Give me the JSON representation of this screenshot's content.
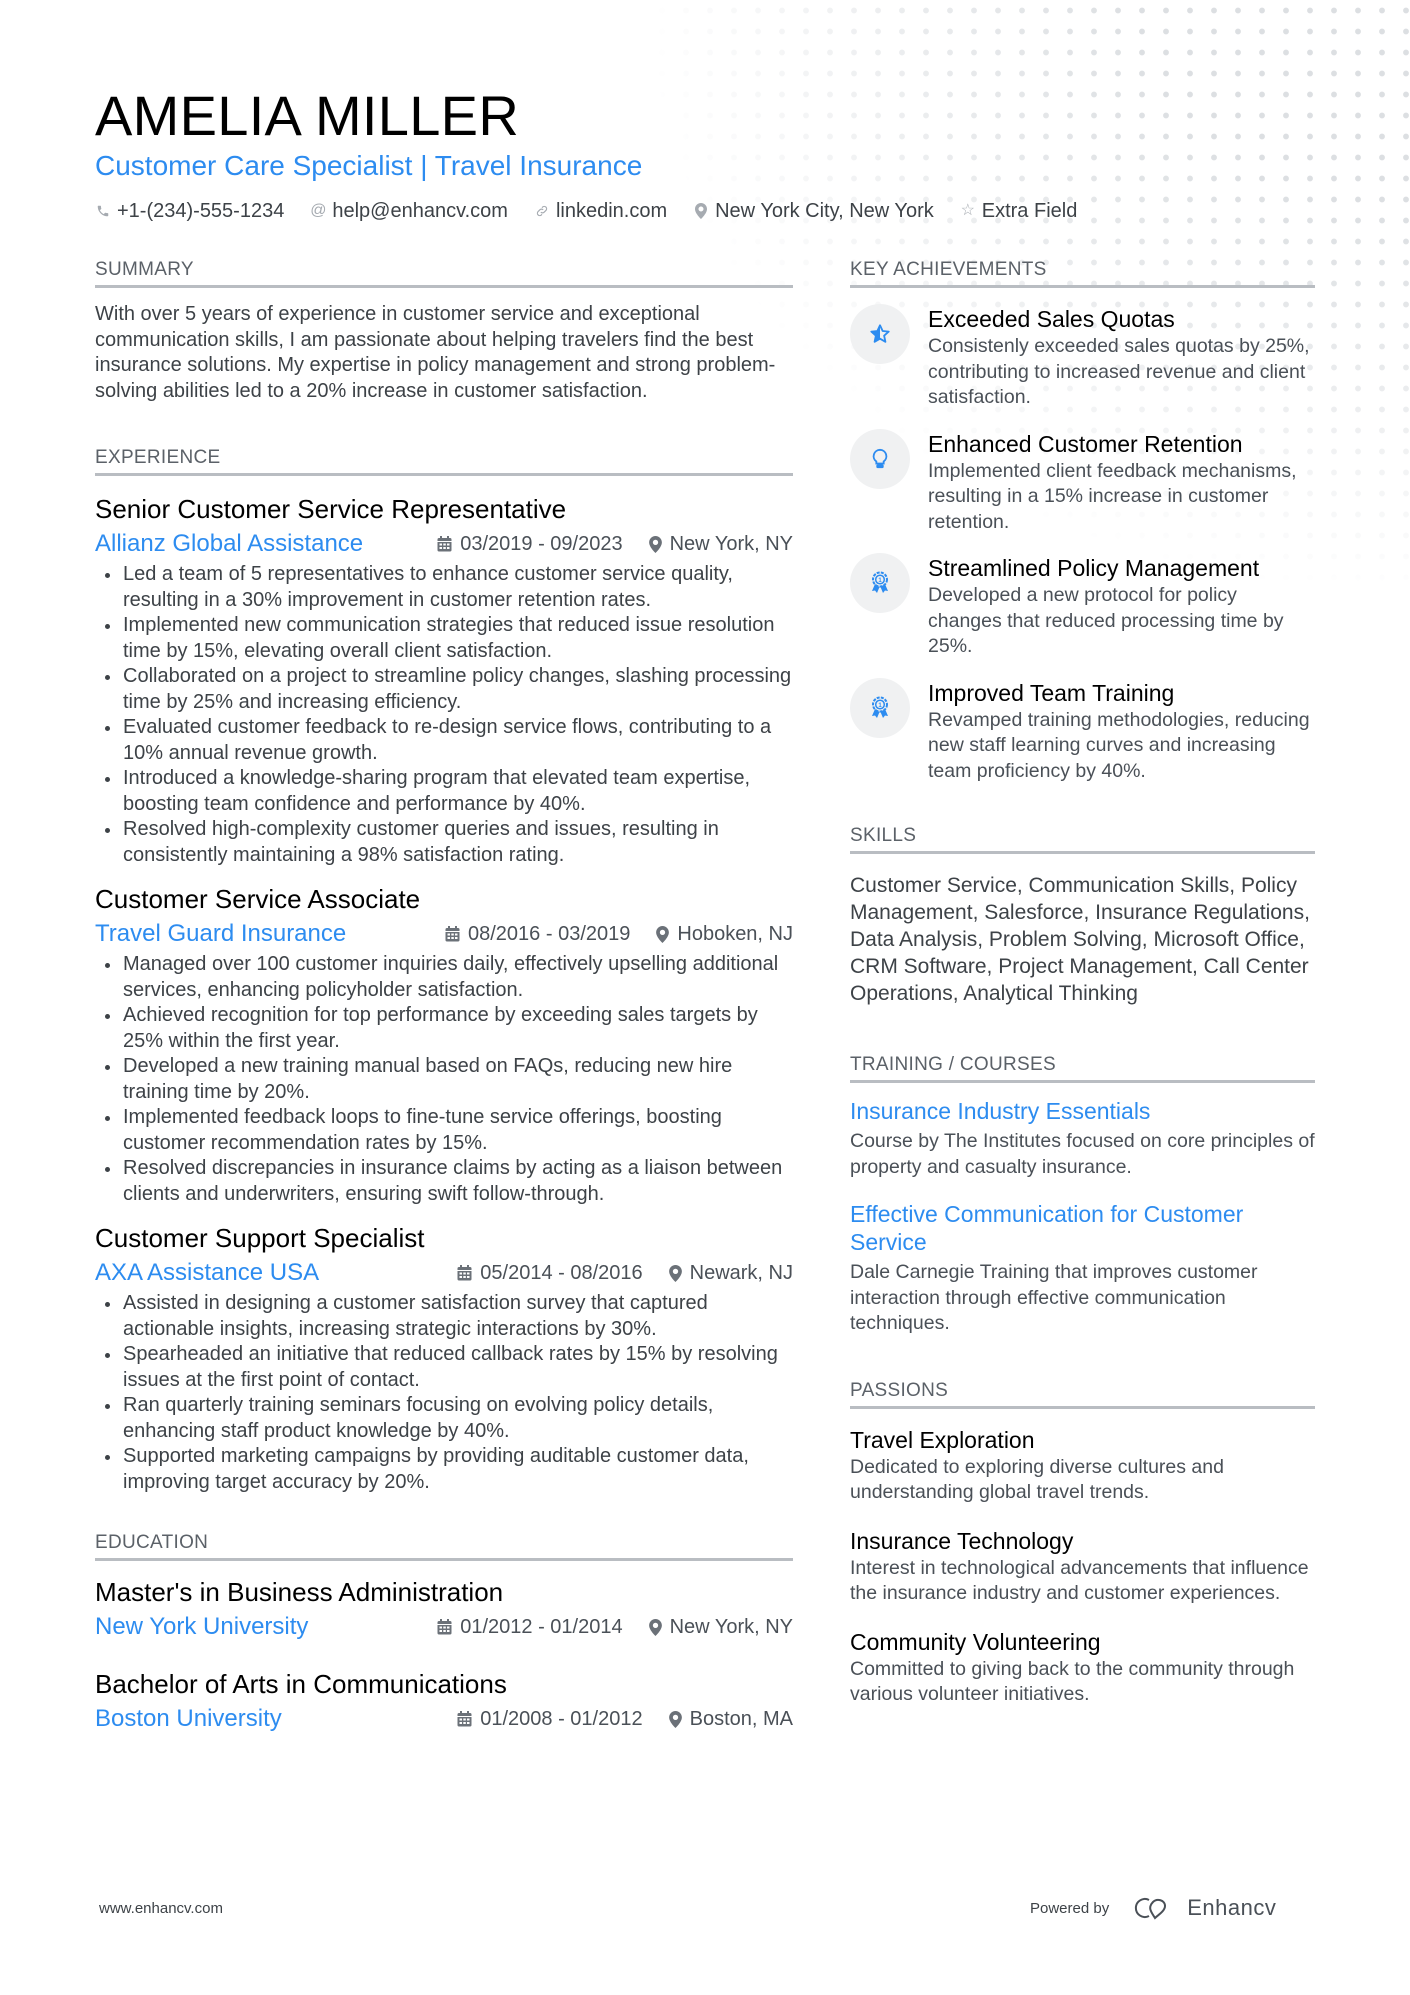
{
  "header": {
    "name": "AMELIA MILLER",
    "title": "Customer Care Specialist | Travel Insurance",
    "contacts": [
      {
        "icon": "phone-icon",
        "text": "+1-(234)-555-1234"
      },
      {
        "icon": "at-icon",
        "text": "help@enhancv.com"
      },
      {
        "icon": "link-icon",
        "text": "linkedin.com"
      },
      {
        "icon": "location-pin-icon",
        "text": "New York City, New York"
      },
      {
        "icon": "star-icon",
        "text": "Extra Field"
      }
    ]
  },
  "summary": {
    "heading": "SUMMARY",
    "text": "With over 5 years of experience in customer service and exceptional communication skills, I am passionate about helping travelers find the best insurance solutions. My expertise in policy management and strong problem-solving abilities led to a 20% increase in customer satisfaction."
  },
  "experience": {
    "heading": "EXPERIENCE",
    "jobs": [
      {
        "title": "Senior Customer Service Representative",
        "company": "Allianz Global Assistance",
        "dates": "03/2019 - 09/2023",
        "location": "New York, NY",
        "bullets": [
          "Led a team of 5 representatives to enhance customer service quality, resulting in a 30% improvement in customer retention rates.",
          "Implemented new communication strategies that reduced issue resolution time by 15%, elevating overall client satisfaction.",
          "Collaborated on a project to streamline policy changes, slashing processing time by 25% and increasing efficiency.",
          "Evaluated customer feedback to re-design service flows, contributing to a 10% annual revenue growth.",
          "Introduced a knowledge-sharing program that elevated team expertise, boosting team confidence and performance by 40%.",
          "Resolved high-complexity customer queries and issues, resulting in consistently maintaining a 98% satisfaction rating."
        ]
      },
      {
        "title": "Customer Service Associate",
        "company": "Travel Guard Insurance",
        "dates": "08/2016 - 03/2019",
        "location": "Hoboken, NJ",
        "bullets": [
          "Managed over 100 customer inquiries daily, effectively upselling additional services, enhancing policyholder satisfaction.",
          "Achieved recognition for top performance by exceeding sales targets by 25% within the first year.",
          "Developed a new training manual based on FAQs, reducing new hire training time by 20%.",
          "Implemented feedback loops to fine-tune service offerings, boosting customer recommendation rates by 15%.",
          "Resolved discrepancies in insurance claims by acting as a liaison between clients and underwriters, ensuring swift follow-through."
        ]
      },
      {
        "title": "Customer Support Specialist",
        "company": "AXA Assistance USA",
        "dates": "05/2014 - 08/2016",
        "location": "Newark, NJ",
        "bullets": [
          "Assisted in designing a customer satisfaction survey that captured actionable insights, increasing strategic interactions by 30%.",
          "Spearheaded an initiative that reduced callback rates by 15% by resolving issues at the first point of contact.",
          "Ran quarterly training seminars focusing on evolving policy details, enhancing staff product knowledge by 40%.",
          "Supported marketing campaigns by providing auditable customer data, improving target accuracy by 20%."
        ]
      }
    ]
  },
  "education": {
    "heading": "EDUCATION",
    "items": [
      {
        "degree": "Master's in Business Administration",
        "school": "New York University",
        "dates": "01/2012 - 01/2014",
        "location": "New York, NY"
      },
      {
        "degree": "Bachelor of Arts in Communications",
        "school": "Boston University",
        "dates": "01/2008 - 01/2012",
        "location": "Boston, MA"
      }
    ]
  },
  "achievements": {
    "heading": "KEY ACHIEVEMENTS",
    "items": [
      {
        "icon": "star-half-icon",
        "title": "Exceeded Sales Quotas",
        "desc": "Consistenly exceeded sales quotas by 25%, contributing to increased revenue and client satisfaction."
      },
      {
        "icon": "lightbulb-icon",
        "title": "Enhanced Customer Retention",
        "desc": "Implemented client feedback mechanisms, resulting in a 15% increase in customer retention."
      },
      {
        "icon": "award-ribbon-icon",
        "title": "Streamlined Policy Management",
        "desc": "Developed a new protocol for policy changes that reduced processing time by 25%."
      },
      {
        "icon": "award-ribbon-icon",
        "title": "Improved Team Training",
        "desc": "Revamped training methodologies, reducing new staff learning curves and increasing team proficiency by 40%."
      }
    ]
  },
  "skills": {
    "heading": "SKILLS",
    "text": "Customer Service, Communication Skills, Policy Management, Salesforce, Insurance Regulations, Data Analysis, Problem Solving, Microsoft Office, CRM Software, Project Management, Call Center Operations, Analytical Thinking"
  },
  "training": {
    "heading": "TRAINING / COURSES",
    "items": [
      {
        "title": "Insurance Industry Essentials",
        "desc": "Course by The Institutes focused on core principles of property and casualty insurance."
      },
      {
        "title": "Effective Communication for Customer Service",
        "desc": "Dale Carnegie Training that improves customer interaction through effective communication techniques."
      }
    ]
  },
  "passions": {
    "heading": "PASSIONS",
    "items": [
      {
        "title": "Travel Exploration",
        "desc": "Dedicated to exploring diverse cultures and understanding global travel trends."
      },
      {
        "title": "Insurance Technology",
        "desc": "Interest in technological advancements that influence the insurance industry and customer experiences."
      },
      {
        "title": "Community Volunteering",
        "desc": "Committed to giving back to the community through various volunteer initiatives."
      }
    ]
  },
  "footer": {
    "website": "www.enhancv.com",
    "powered_by": "Powered by",
    "brand": "Enhancv"
  },
  "colors": {
    "accent": "#2d8cf0",
    "text": "#3d4247",
    "rule": "#b9bdc2"
  }
}
